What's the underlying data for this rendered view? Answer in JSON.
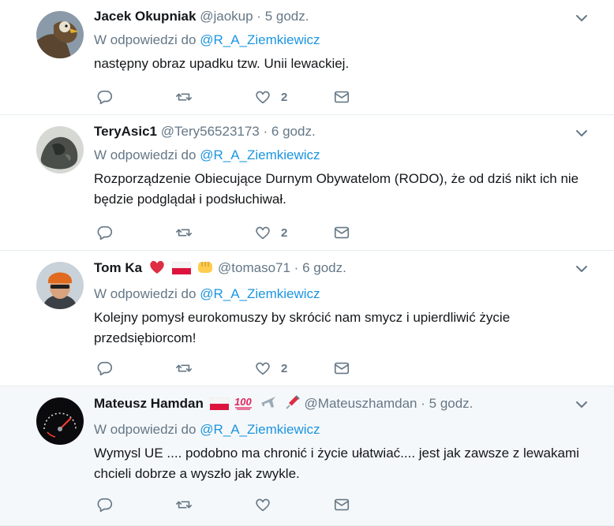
{
  "reply_prefix": "W odpowiedzi do",
  "tweets": [
    {
      "fullname": "Jacek Okupniak",
      "handle": "@jaokup",
      "separator": "·",
      "time": "5 godz.",
      "reply_to": "@R_A_Ziemkiewicz",
      "text": "następny obraz upadku tzw. Unii lewackiej.",
      "like_count": "2"
    },
    {
      "fullname": "TeryAsic1",
      "handle": "@Tery56523173",
      "separator": "·",
      "time": "6 godz.",
      "reply_to": "@R_A_Ziemkiewicz",
      "text": "Rozporządzenie Obiecujące Durnym Obywatelom (RODO), że od dziś nikt ich nie będzie podglądał i podsłuchiwał.",
      "like_count": "2"
    },
    {
      "fullname": "Tom Ka",
      "handle": "@tomaso71",
      "separator": "·",
      "time": "6 godz.",
      "reply_to": "@R_A_Ziemkiewicz",
      "text": "Kolejny pomysł eurokomuszy by skrócić nam smycz i upierdliwić życie przedsiębiorcom!",
      "like_count": "2"
    },
    {
      "fullname": "Mateusz Hamdan",
      "handle": "@Mateuszhamdan",
      "separator": "·",
      "time": "5 godz.",
      "reply_to": "@R_A_Ziemkiewicz",
      "text": "Wymysl UE .... podobno ma chronić i życie ułatwiać.... jest jak zawsze z lewakami chcieli dobrze a wyszło jak zwykle.",
      "like_count": ""
    }
  ],
  "icons": {
    "reply": "reply-icon",
    "retweet": "retweet-icon",
    "like": "heart-icon",
    "dm": "envelope-icon",
    "more": "chevron-down-icon"
  },
  "colors": {
    "link": "#1b95e0",
    "muted": "#657786",
    "text": "#14171a",
    "highlight_bg": "#f5f8fa",
    "border": "#e6ecf0"
  }
}
